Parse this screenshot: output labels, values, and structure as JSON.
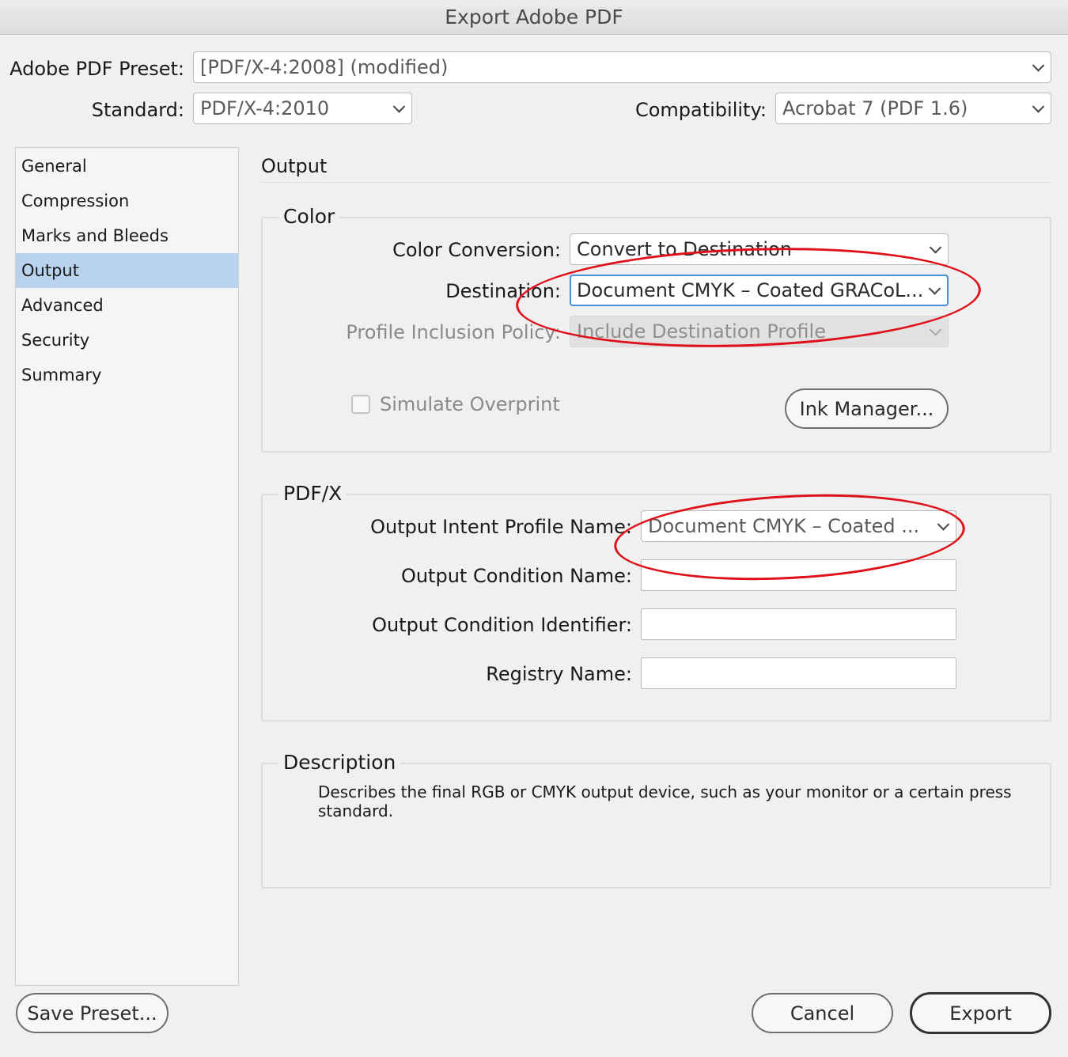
{
  "window": {
    "title": "Export Adobe PDF"
  },
  "preset": {
    "label": "Adobe PDF Preset:",
    "value": "[PDF/X-4:2008] (modified)"
  },
  "standard": {
    "label": "Standard:",
    "value": "PDF/X-4:2010"
  },
  "compatibility": {
    "label": "Compatibility:",
    "value": "Acrobat 7 (PDF 1.6)"
  },
  "sidebar": {
    "items": [
      {
        "label": "General"
      },
      {
        "label": "Compression"
      },
      {
        "label": "Marks and Bleeds"
      },
      {
        "label": "Output"
      },
      {
        "label": "Advanced"
      },
      {
        "label": "Security"
      },
      {
        "label": "Summary"
      }
    ],
    "selected": "Output"
  },
  "panel": {
    "title": "Output"
  },
  "color": {
    "legend": "Color",
    "conversion_label": "Color Conversion:",
    "conversion_value": "Convert to Destination",
    "destination_label": "Destination:",
    "destination_value": "Document CMYK – Coated GRACoL...",
    "policy_label": "Profile Inclusion Policy:",
    "policy_value": "Include Destination Profile",
    "simulate_label": "Simulate Overprint",
    "ink_button": "Ink Manager..."
  },
  "pdfx": {
    "legend": "PDF/X",
    "intent_label": "Output Intent Profile Name:",
    "intent_value": "Document CMYK – Coated ...",
    "condition_name_label": "Output Condition Name:",
    "condition_name_value": "",
    "condition_id_label": "Output Condition Identifier:",
    "condition_id_value": "",
    "registry_label": "Registry Name:",
    "registry_value": ""
  },
  "description": {
    "legend": "Description",
    "text": "Describes the final RGB or CMYK output device, such as your monitor or a certain press standard."
  },
  "footer": {
    "save_preset": "Save Preset...",
    "cancel": "Cancel",
    "export": "Export"
  },
  "colors": {
    "selection": "#b9d3ef",
    "focus_ring": "#4a90d9",
    "annotation": "#e0101a"
  }
}
